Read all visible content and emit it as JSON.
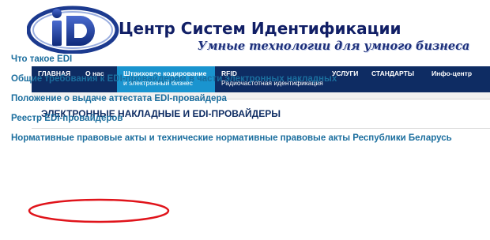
{
  "header": {
    "site_title": "Центр Систем Идентификации",
    "slogan": "Умные технологии для умного бизнеса",
    "logo_letters": "iD"
  },
  "nav": {
    "items": [
      {
        "label": "ГЛАВНАЯ",
        "sub": ""
      },
      {
        "label": "О нас",
        "sub": ""
      },
      {
        "label": "Штриховое кодирование",
        "sub": "и электронный бизнес"
      },
      {
        "label": "RFID",
        "sub": "Радиочастотная идентификация"
      },
      {
        "label": "УСЛУГИ",
        "sub": ""
      },
      {
        "label": "СТАНДАРТЫ",
        "sub": ""
      },
      {
        "label": "Инфо-центр",
        "sub": ""
      }
    ],
    "active_index": 2
  },
  "section": {
    "title": "ЭЛЕКТРОННЫЕ НАКЛАДНЫЕ И EDI-ПРОВАЙДЕРЫ"
  },
  "links": [
    "Что такое EDI",
    "Общие требования к EDI-провайдерам в части электронных накладных",
    "Положение о выдаче аттестата EDI-провайдера",
    "Реестр EDI-провайдеров",
    "Нормативные правовые акты и технические нормативные правовые акты Республики Беларусь"
  ],
  "colors": {
    "nav_bg": "#0e2c63",
    "nav_active": "#1a94cf",
    "link": "#1b6e9e",
    "highlight_ring": "#e0141b"
  }
}
